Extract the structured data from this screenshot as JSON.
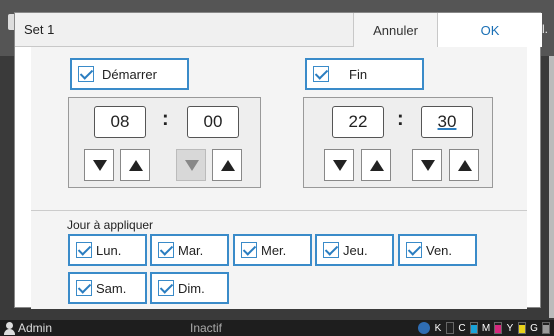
{
  "background": {
    "tail_text": "al."
  },
  "dialog": {
    "title": "Set 1",
    "cancel_label": "Annuler",
    "ok_label": "OK"
  },
  "start": {
    "label": "Démarrer",
    "checked": true,
    "hour": "08",
    "minute": "00",
    "separator": ":"
  },
  "end": {
    "label": "Fin",
    "checked": true,
    "hour": "22",
    "minute": "30",
    "separator": ":"
  },
  "days": {
    "label": "Jour à appliquer",
    "items": [
      {
        "label": "Lun.",
        "checked": true
      },
      {
        "label": "Mar.",
        "checked": true
      },
      {
        "label": "Mer.",
        "checked": true
      },
      {
        "label": "Jeu.",
        "checked": true
      },
      {
        "label": "Ven.",
        "checked": true
      },
      {
        "label": "Sam.",
        "checked": true
      },
      {
        "label": "Dim.",
        "checked": true
      }
    ]
  },
  "statusbar": {
    "user": "Admin",
    "state": "Inactif",
    "ink": [
      {
        "label": "K",
        "color": "#222222",
        "level": 0.85
      },
      {
        "label": "C",
        "color": "#1aa3d9",
        "level": 0.85
      },
      {
        "label": "M",
        "color": "#d6287d",
        "level": 0.85
      },
      {
        "label": "Y",
        "color": "#e8d21b",
        "level": 0.85
      },
      {
        "label": "G",
        "color": "#9a9a9a",
        "level": 0.85
      }
    ]
  },
  "colors": {
    "accent": "#3a8bc9",
    "ok_text": "#1a6fb5"
  }
}
